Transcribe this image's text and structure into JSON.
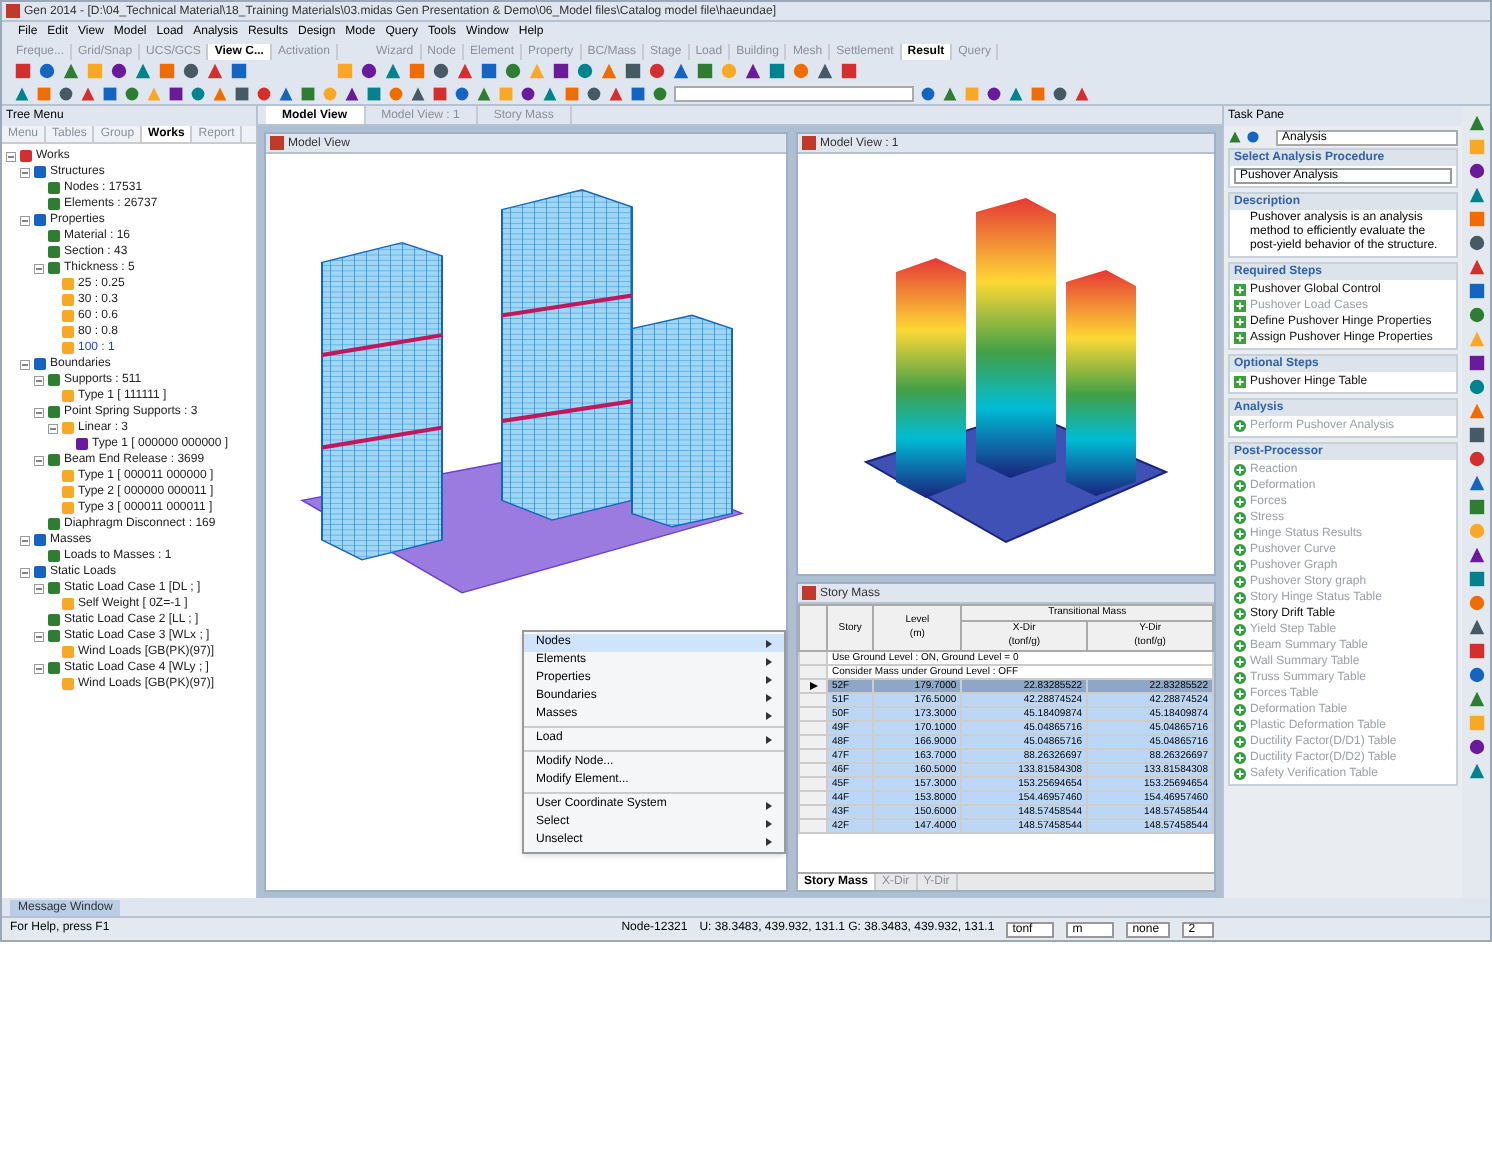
{
  "window": {
    "title": "Gen 2014 - [D:\\04_Technical Material\\18_Training Materials\\03.midas Gen Presentation & Demo\\06_Model files\\Catalog model file\\haeundae]"
  },
  "menu": [
    "File",
    "Edit",
    "View",
    "Model",
    "Load",
    "Analysis",
    "Results",
    "Design",
    "Mode",
    "Query",
    "Tools",
    "Window",
    "Help"
  ],
  "toolbar_tabs_left": [
    {
      "label": "Freque...",
      "selected": false
    },
    {
      "label": "Grid/Snap",
      "selected": false
    },
    {
      "label": "UCS/GCS",
      "selected": false
    },
    {
      "label": "View C...",
      "selected": true
    },
    {
      "label": "Activation",
      "selected": false
    }
  ],
  "toolbar_tabs_right": [
    {
      "label": "Wizard",
      "selected": false
    },
    {
      "label": "Node",
      "selected": false
    },
    {
      "label": "Element",
      "selected": false
    },
    {
      "label": "Property",
      "selected": false
    },
    {
      "label": "BC/Mass",
      "selected": false
    },
    {
      "label": "Stage",
      "selected": false
    },
    {
      "label": "Load",
      "selected": false
    },
    {
      "label": "Building",
      "selected": false
    },
    {
      "label": "Mesh",
      "selected": false
    },
    {
      "label": "Settlement",
      "selected": false
    },
    {
      "label": "Result",
      "selected": true
    },
    {
      "label": "Query",
      "selected": false
    }
  ],
  "tree_menu": {
    "title": "Tree Menu",
    "tabs": [
      {
        "label": "Menu",
        "selected": false
      },
      {
        "label": "Tables",
        "selected": false
      },
      {
        "label": "Group",
        "selected": false
      },
      {
        "label": "Works",
        "selected": true
      },
      {
        "label": "Report",
        "selected": false
      }
    ],
    "items": [
      {
        "label": "Works",
        "selected": false,
        "expanded": true,
        "children": [
          {
            "label": "Structures",
            "selected": false,
            "expanded": true,
            "children": [
              {
                "label": "Nodes : 17531",
                "selected": false
              },
              {
                "label": "Elements : 26737",
                "selected": false
              }
            ]
          },
          {
            "label": "Properties",
            "selected": false,
            "expanded": true,
            "children": [
              {
                "label": "Material : 16",
                "selected": false
              },
              {
                "label": "Section : 43",
                "selected": false
              },
              {
                "label": "Thickness : 5",
                "selected": false,
                "expanded": true,
                "children": [
                  {
                    "label": "25 : 0.25",
                    "selected": false
                  },
                  {
                    "label": "30 : 0.3",
                    "selected": false
                  },
                  {
                    "label": "60 : 0.6",
                    "selected": false
                  },
                  {
                    "label": "80 : 0.8",
                    "selected": false
                  },
                  {
                    "label": "100 : 1",
                    "selected": true
                  }
                ]
              }
            ]
          },
          {
            "label": "Boundaries",
            "selected": false,
            "expanded": true,
            "children": [
              {
                "label": "Supports : 511",
                "selected": false,
                "expanded": true,
                "children": [
                  {
                    "label": "Type 1 [ 111111 ]",
                    "selected": false
                  }
                ]
              },
              {
                "label": "Point Spring Supports : 3",
                "selected": false,
                "expanded": true,
                "children": [
                  {
                    "label": "Linear : 3",
                    "selected": false,
                    "expanded": true,
                    "children": [
                      {
                        "label": "Type 1 [ 000000 000000 ]",
                        "selected": false
                      }
                    ]
                  }
                ]
              },
              {
                "label": "Beam End Release : 3699",
                "selected": false,
                "expanded": true,
                "children": [
                  {
                    "label": "Type 1 [ 000011 000000 ]",
                    "selected": false
                  },
                  {
                    "label": "Type 2 [ 000000 000011 ]",
                    "selected": false
                  },
                  {
                    "label": "Type 3 [ 000011 000011 ]",
                    "selected": false
                  }
                ]
              },
              {
                "label": "Diaphragm Disconnect : 169",
                "selected": false
              }
            ]
          },
          {
            "label": "Masses",
            "selected": false,
            "expanded": true,
            "children": [
              {
                "label": "Loads to Masses : 1",
                "selected": false
              }
            ]
          },
          {
            "label": "Static Loads",
            "selected": false,
            "expanded": true,
            "children": [
              {
                "label": "Static Load Case 1 [DL ; ]",
                "selected": false,
                "expanded": true,
                "children": [
                  {
                    "label": "Self Weight [ 0Z=-1 ]",
                    "selected": false
                  }
                ]
              },
              {
                "label": "Static Load Case 2 [LL ; ]",
                "selected": false
              },
              {
                "label": "Static Load Case 3 [WLx ; ]",
                "selected": false,
                "expanded": true,
                "children": [
                  {
                    "label": "Wind Loads [GB(PK)(97)]",
                    "selected": false
                  }
                ]
              },
              {
                "label": "Static Load Case 4 [WLy ; ]",
                "selected": false,
                "expanded": true,
                "children": [
                  {
                    "label": "Wind Loads [GB(PK)(97)]",
                    "selected": false
                  }
                ]
              }
            ]
          }
        ]
      }
    ]
  },
  "view_tabs": [
    {
      "label": "Model View",
      "selected": true
    },
    {
      "label": "Model View : 1",
      "selected": false
    },
    {
      "label": "Story Mass",
      "selected": false
    }
  ],
  "model_view": {
    "title": "Model View"
  },
  "model_view_1": {
    "title": "Model View : 1"
  },
  "context_menu": {
    "groups": [
      [
        {
          "label": "Nodes",
          "submenu": true,
          "selected": true
        },
        {
          "label": "Elements",
          "submenu": true,
          "selected": false
        },
        {
          "label": "Properties",
          "submenu": true,
          "selected": false
        },
        {
          "label": "Boundaries",
          "submenu": true,
          "selected": false
        },
        {
          "label": "Masses",
          "submenu": true,
          "selected": false
        }
      ],
      [
        {
          "label": "Load",
          "submenu": true,
          "selected": false
        }
      ],
      [
        {
          "label": "Modify Node...",
          "submenu": false,
          "selected": false
        },
        {
          "label": "Modify Element...",
          "submenu": false,
          "selected": false
        }
      ],
      [
        {
          "label": "User Coordinate System",
          "submenu": true,
          "selected": false
        },
        {
          "label": "Select",
          "submenu": true,
          "selected": false
        },
        {
          "label": "Unselect",
          "submenu": true,
          "selected": false
        }
      ]
    ]
  },
  "story_mass": {
    "title": "Story Mass",
    "columns": {
      "story": "Story",
      "level": "Level\n(m)",
      "group": "Transitional Mass",
      "x": "X-Dir\n(tonf/g)",
      "y": "Y-Dir\n(tonf/g)"
    },
    "notes": [
      "Use Ground Level : ON, Ground Level = 0",
      "Consider Mass under Ground Level : OFF"
    ],
    "rows": [
      {
        "cells": [
          "52F",
          "179.7000",
          "22.83285522",
          "22.83285522"
        ],
        "current": true,
        "selected": true
      },
      {
        "cells": [
          "51F",
          "176.5000",
          "42.28874524",
          "42.28874524"
        ],
        "current": false,
        "selected": true
      },
      {
        "cells": [
          "50F",
          "173.3000",
          "45.18409874",
          "45.18409874"
        ],
        "current": false,
        "selected": true
      },
      {
        "cells": [
          "49F",
          "170.1000",
          "45.04865716",
          "45.04865716"
        ],
        "current": false,
        "selected": true
      },
      {
        "cells": [
          "48F",
          "166.9000",
          "45.04865716",
          "45.04865716"
        ],
        "current": false,
        "selected": true
      },
      {
        "cells": [
          "47F",
          "163.7000",
          "88.26326697",
          "88.26326697"
        ],
        "current": false,
        "selected": true
      },
      {
        "cells": [
          "46F",
          "160.5000",
          "133.81584308",
          "133.81584308"
        ],
        "current": false,
        "selected": true
      },
      {
        "cells": [
          "45F",
          "157.3000",
          "153.25694654",
          "153.25694654"
        ],
        "current": false,
        "selected": true
      },
      {
        "cells": [
          "44F",
          "153.8000",
          "154.46957460",
          "154.46957460"
        ],
        "current": false,
        "selected": true
      },
      {
        "cells": [
          "43F",
          "150.6000",
          "148.57458544",
          "148.57458544"
        ],
        "current": false,
        "selected": true
      },
      {
        "cells": [
          "42F",
          "147.4000",
          "148.57458544",
          "148.57458544"
        ],
        "current": false,
        "selected": true
      }
    ],
    "sheet_tabs": [
      {
        "label": "Story Mass",
        "selected": true
      },
      {
        "label": "X-Dir",
        "selected": false
      },
      {
        "label": "Y-Dir",
        "selected": false
      }
    ]
  },
  "task_pane": {
    "title": "Task Pane",
    "mode": "Analysis",
    "sections": [
      {
        "kind": "select",
        "title": "Select Analysis Procedure",
        "value": "Pushover Analysis"
      },
      {
        "kind": "text",
        "title": "Description",
        "text": "Pushover analysis is an analysis method to efficiently evaluate the post-yield behavior of the structure."
      },
      {
        "kind": "steps",
        "title": "Required Steps",
        "items": [
          {
            "label": "Pushover Global Control",
            "disabled": false
          },
          {
            "label": "Pushover Load Cases",
            "disabled": true
          },
          {
            "label": "Define Pushover Hinge Properties",
            "disabled": false
          },
          {
            "label": "Assign Pushover Hinge Properties",
            "disabled": false
          }
        ]
      },
      {
        "kind": "steps",
        "title": "Optional Steps",
        "items": [
          {
            "label": "Pushover Hinge Table",
            "disabled": false
          }
        ]
      },
      {
        "kind": "actions",
        "title": "Analysis",
        "items": [
          {
            "label": "Perform Pushover Analysis",
            "disabled": true
          }
        ]
      },
      {
        "kind": "actions",
        "title": "Post-Processor",
        "items": [
          {
            "label": "Reaction",
            "disabled": true
          },
          {
            "label": "Deformation",
            "disabled": true
          },
          {
            "label": "Forces",
            "disabled": true
          },
          {
            "label": "Stress",
            "disabled": true
          },
          {
            "label": "Hinge Status Results",
            "disabled": true
          },
          {
            "label": "Pushover Curve",
            "disabled": true
          },
          {
            "label": "Pushover Graph",
            "disabled": true
          },
          {
            "label": "Pushover Story graph",
            "disabled": true
          },
          {
            "label": "Story Hinge Status Table",
            "disabled": true
          },
          {
            "label": "Story Drift Table",
            "disabled": false
          },
          {
            "label": "Yield Step Table",
            "disabled": true
          },
          {
            "label": "Beam Summary Table",
            "disabled": true
          },
          {
            "label": "Wall Summary Table",
            "disabled": true
          },
          {
            "label": "Truss Summary Table",
            "disabled": true
          },
          {
            "label": "Forces Table",
            "disabled": true
          },
          {
            "label": "Deformation Table",
            "disabled": true
          },
          {
            "label": "Plastic Deformation Table",
            "disabled": true
          },
          {
            "label": "Ductility Factor(D/D1) Table",
            "disabled": true
          },
          {
            "label": "Ductility Factor(D/D2) Table",
            "disabled": true
          },
          {
            "label": "Safety Verification Table",
            "disabled": true
          }
        ]
      }
    ]
  },
  "message_window": {
    "title": "Message Window"
  },
  "status_bar": {
    "help": "For Help, press F1",
    "node": "Node-12321",
    "coords": "U: 38.3483, 439.932, 131.1  G: 38.3483, 439.932, 131.1",
    "force_unit": "tonf",
    "length_unit": "m",
    "filter": "none",
    "page": "2"
  }
}
